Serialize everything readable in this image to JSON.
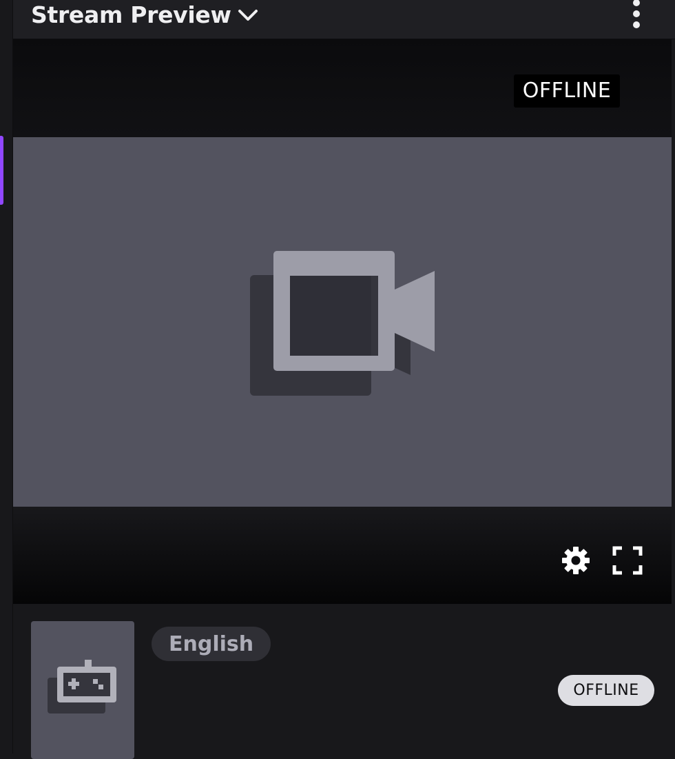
{
  "header": {
    "title": "Stream Preview",
    "chevron_icon": "chevron-down-icon",
    "more_icon": "more-vertical-icon"
  },
  "player": {
    "status_overlay": "OFFLINE",
    "placeholder_icon": "video-camera-icon",
    "settings_icon": "gear-icon",
    "fullscreen_icon": "fullscreen-icon"
  },
  "stream_info": {
    "category_icon": "gamepad-icon",
    "language_tag": "English",
    "status_badge": "OFFLINE"
  },
  "colors": {
    "accent": "#9147ff",
    "panel_bg": "#18181b",
    "header_bg": "#1f1f23",
    "video_placeholder_bg": "#53535f",
    "icon_gray": "#9d9da8",
    "status_pill_bg": "#dedee3"
  }
}
